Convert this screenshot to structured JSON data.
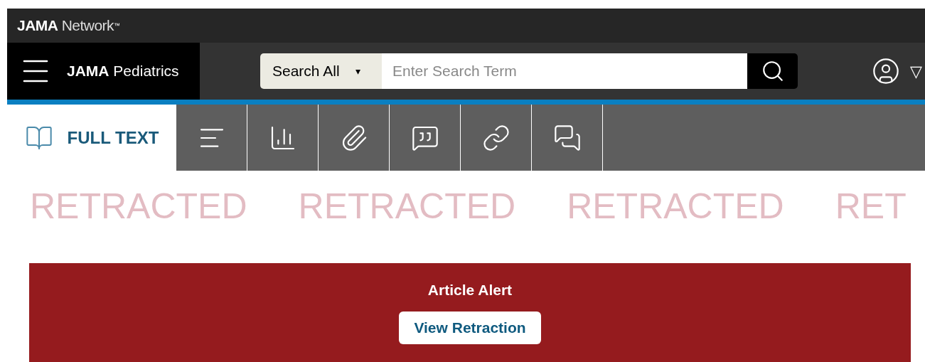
{
  "network_bar": {
    "brand_bold": "JAMA",
    "brand_light": "Network",
    "trademark": "™"
  },
  "journal_bar": {
    "journal_bold": "JAMA",
    "journal_light": "Pediatrics",
    "search": {
      "scope": "Search All",
      "scope_caret": "▾",
      "placeholder": "Enter Search Term"
    },
    "account_caret": "▽"
  },
  "tabs": [
    {
      "kind": "full_text",
      "label": "FULL TEXT",
      "selected": true
    },
    {
      "kind": "outline",
      "selected": false
    },
    {
      "kind": "figures",
      "selected": false
    },
    {
      "kind": "supplement",
      "selected": false
    },
    {
      "kind": "cite",
      "selected": false
    },
    {
      "kind": "links",
      "selected": false
    },
    {
      "kind": "comments",
      "selected": false
    }
  ],
  "retracted_marks": [
    "RETRACTED",
    "RETRACTED",
    "RETRACTED",
    "RET"
  ],
  "alert": {
    "title": "Article Alert",
    "button": "View Retraction"
  }
}
